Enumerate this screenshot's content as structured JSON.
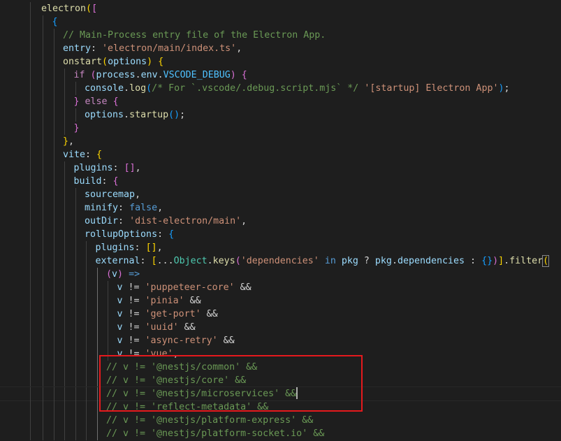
{
  "editor": {
    "highlight_color": "#e5191d",
    "lines": [
      {
        "indent": 0,
        "tokens": [
          {
            "t": "electron",
            "c": "t-fn"
          },
          {
            "t": "(",
            "c": "b1"
          },
          {
            "t": "[",
            "c": "b2"
          }
        ]
      },
      {
        "indent": 1,
        "tokens": [
          {
            "t": "{",
            "c": "b3"
          }
        ]
      },
      {
        "indent": 2,
        "tokens": [
          {
            "t": "// Main-Process entry file of the Electron App.",
            "c": "t-cm"
          }
        ]
      },
      {
        "indent": 2,
        "tokens": [
          {
            "t": "entry",
            "c": "t-prop"
          },
          {
            "t": ": ",
            "c": "t-op"
          },
          {
            "t": "'electron/main/index.ts'",
            "c": "t-str"
          },
          {
            "t": ",",
            "c": "t-op"
          }
        ]
      },
      {
        "indent": 2,
        "tokens": [
          {
            "t": "onstart",
            "c": "t-fn"
          },
          {
            "t": "(",
            "c": "b1"
          },
          {
            "t": "options",
            "c": "t-var"
          },
          {
            "t": ")",
            "c": "b1"
          },
          {
            "t": " ",
            "c": "t-op"
          },
          {
            "t": "{",
            "c": "b1"
          }
        ]
      },
      {
        "indent": 3,
        "tokens": [
          {
            "t": "if",
            "c": "t-kw"
          },
          {
            "t": " ",
            "c": "t-op"
          },
          {
            "t": "(",
            "c": "b2"
          },
          {
            "t": "process",
            "c": "t-var"
          },
          {
            "t": ".",
            "c": "t-op"
          },
          {
            "t": "env",
            "c": "t-var"
          },
          {
            "t": ".",
            "c": "t-op"
          },
          {
            "t": "VSCODE_DEBUG",
            "c": "t-const"
          },
          {
            "t": ")",
            "c": "b2"
          },
          {
            "t": " ",
            "c": "t-op"
          },
          {
            "t": "{",
            "c": "b2"
          }
        ]
      },
      {
        "indent": 4,
        "tokens": [
          {
            "t": "console",
            "c": "t-var"
          },
          {
            "t": ".",
            "c": "t-op"
          },
          {
            "t": "log",
            "c": "t-fn"
          },
          {
            "t": "(",
            "c": "b3"
          },
          {
            "t": "/* For `.vscode/.debug.script.mjs` */",
            "c": "t-cm"
          },
          {
            "t": " ",
            "c": "t-op"
          },
          {
            "t": "'[startup] Electron App'",
            "c": "t-str"
          },
          {
            "t": ")",
            "c": "b3"
          },
          {
            "t": ";",
            "c": "t-op"
          }
        ]
      },
      {
        "indent": 3,
        "tokens": [
          {
            "t": "}",
            "c": "b2"
          },
          {
            "t": " ",
            "c": "t-op"
          },
          {
            "t": "else",
            "c": "t-kw"
          },
          {
            "t": " ",
            "c": "t-op"
          },
          {
            "t": "{",
            "c": "b2"
          }
        ]
      },
      {
        "indent": 4,
        "tokens": [
          {
            "t": "options",
            "c": "t-var"
          },
          {
            "t": ".",
            "c": "t-op"
          },
          {
            "t": "startup",
            "c": "t-fn"
          },
          {
            "t": "(",
            "c": "b3"
          },
          {
            "t": ")",
            "c": "b3"
          },
          {
            "t": ";",
            "c": "t-op"
          }
        ]
      },
      {
        "indent": 3,
        "tokens": [
          {
            "t": "}",
            "c": "b2"
          }
        ]
      },
      {
        "indent": 2,
        "tokens": [
          {
            "t": "}",
            "c": "b1"
          },
          {
            "t": ",",
            "c": "t-op"
          }
        ]
      },
      {
        "indent": 2,
        "tokens": [
          {
            "t": "vite",
            "c": "t-prop"
          },
          {
            "t": ": ",
            "c": "t-op"
          },
          {
            "t": "{",
            "c": "b1"
          }
        ]
      },
      {
        "indent": 3,
        "tokens": [
          {
            "t": "plugins",
            "c": "t-prop"
          },
          {
            "t": ": ",
            "c": "t-op"
          },
          {
            "t": "[]",
            "c": "b2"
          },
          {
            "t": ",",
            "c": "t-op"
          }
        ]
      },
      {
        "indent": 3,
        "tokens": [
          {
            "t": "build",
            "c": "t-prop"
          },
          {
            "t": ": ",
            "c": "t-op"
          },
          {
            "t": "{",
            "c": "b2"
          }
        ]
      },
      {
        "indent": 4,
        "tokens": [
          {
            "t": "sourcemap",
            "c": "t-prop"
          },
          {
            "t": ",",
            "c": "t-op"
          }
        ]
      },
      {
        "indent": 4,
        "tokens": [
          {
            "t": "minify",
            "c": "t-prop"
          },
          {
            "t": ": ",
            "c": "t-op"
          },
          {
            "t": "false",
            "c": "t-kw2"
          },
          {
            "t": ",",
            "c": "t-op"
          }
        ]
      },
      {
        "indent": 4,
        "tokens": [
          {
            "t": "outDir",
            "c": "t-prop"
          },
          {
            "t": ": ",
            "c": "t-op"
          },
          {
            "t": "'dist-electron/main'",
            "c": "t-str"
          },
          {
            "t": ",",
            "c": "t-op"
          }
        ]
      },
      {
        "indent": 4,
        "tokens": [
          {
            "t": "rollupOptions",
            "c": "t-prop"
          },
          {
            "t": ": ",
            "c": "t-op"
          },
          {
            "t": "{",
            "c": "b3"
          }
        ]
      },
      {
        "indent": 5,
        "tokens": [
          {
            "t": "plugins",
            "c": "t-prop"
          },
          {
            "t": ": ",
            "c": "t-op"
          },
          {
            "t": "[]",
            "c": "b1"
          },
          {
            "t": ",",
            "c": "t-op"
          }
        ]
      },
      {
        "indent": 5,
        "tokens": [
          {
            "t": "external",
            "c": "t-prop"
          },
          {
            "t": ": ",
            "c": "t-op"
          },
          {
            "t": "[",
            "c": "b1"
          },
          {
            "t": "...",
            "c": "t-op"
          },
          {
            "t": "Object",
            "c": "t-type"
          },
          {
            "t": ".",
            "c": "t-op"
          },
          {
            "t": "keys",
            "c": "t-fn"
          },
          {
            "t": "(",
            "c": "b2"
          },
          {
            "t": "'dependencies'",
            "c": "t-str"
          },
          {
            "t": " ",
            "c": "t-op"
          },
          {
            "t": "in",
            "c": "t-kw2"
          },
          {
            "t": " ",
            "c": "t-op"
          },
          {
            "t": "pkg",
            "c": "t-var"
          },
          {
            "t": " ? ",
            "c": "t-op"
          },
          {
            "t": "pkg",
            "c": "t-var"
          },
          {
            "t": ".",
            "c": "t-op"
          },
          {
            "t": "dependencies",
            "c": "t-var"
          },
          {
            "t": " : ",
            "c": "t-op"
          },
          {
            "t": "{}",
            "c": "b3"
          },
          {
            "t": ")",
            "c": "b2"
          },
          {
            "t": "]",
            "c": "b1"
          },
          {
            "t": ".",
            "c": "t-op"
          },
          {
            "t": "filter",
            "c": "t-fn"
          },
          {
            "t": "(",
            "c": "b1 bracket-match"
          }
        ]
      },
      {
        "indent": 6,
        "tokens": [
          {
            "t": "(",
            "c": "b2"
          },
          {
            "t": "v",
            "c": "t-var"
          },
          {
            "t": ")",
            "c": "b2"
          },
          {
            "t": " ",
            "c": "t-op"
          },
          {
            "t": "=>",
            "c": "t-kw2"
          }
        ]
      },
      {
        "indent": 7,
        "tokens": [
          {
            "t": "v",
            "c": "t-var"
          },
          {
            "t": " != ",
            "c": "t-op"
          },
          {
            "t": "'puppeteer-core'",
            "c": "t-str"
          },
          {
            "t": " &&",
            "c": "t-op"
          }
        ]
      },
      {
        "indent": 7,
        "tokens": [
          {
            "t": "v",
            "c": "t-var"
          },
          {
            "t": " != ",
            "c": "t-op"
          },
          {
            "t": "'pinia'",
            "c": "t-str"
          },
          {
            "t": " &&",
            "c": "t-op"
          }
        ]
      },
      {
        "indent": 7,
        "tokens": [
          {
            "t": "v",
            "c": "t-var"
          },
          {
            "t": " != ",
            "c": "t-op"
          },
          {
            "t": "'get-port'",
            "c": "t-str"
          },
          {
            "t": " &&",
            "c": "t-op"
          }
        ]
      },
      {
        "indent": 7,
        "tokens": [
          {
            "t": "v",
            "c": "t-var"
          },
          {
            "t": " != ",
            "c": "t-op"
          },
          {
            "t": "'uuid'",
            "c": "t-str"
          },
          {
            "t": " &&",
            "c": "t-op"
          }
        ]
      },
      {
        "indent": 7,
        "tokens": [
          {
            "t": "v",
            "c": "t-var"
          },
          {
            "t": " != ",
            "c": "t-op"
          },
          {
            "t": "'async-retry'",
            "c": "t-str"
          },
          {
            "t": " &&",
            "c": "t-op"
          }
        ]
      },
      {
        "indent": 7,
        "tokens": [
          {
            "t": "v",
            "c": "t-var"
          },
          {
            "t": " != ",
            "c": "t-op"
          },
          {
            "t": "'vue'",
            "c": "t-str"
          },
          {
            "t": ",",
            "c": "t-op"
          }
        ]
      },
      {
        "indent": 6,
        "tokens": [
          {
            "t": "// v != '@nestjs/common' &&",
            "c": "t-cm"
          }
        ]
      },
      {
        "indent": 6,
        "tokens": [
          {
            "t": "// v != '@nestjs/core' &&",
            "c": "t-cm"
          }
        ]
      },
      {
        "indent": 6,
        "cursor": true,
        "tokens": [
          {
            "t": "// v != '@nestjs/microservices' &&",
            "c": "t-cm"
          }
        ]
      },
      {
        "indent": 6,
        "tokens": [
          {
            "t": "// v != 'reflect-metadata' &&",
            "c": "t-cm"
          }
        ]
      },
      {
        "indent": 6,
        "tokens": [
          {
            "t": "// v != '@nestjs/platform-express' &&",
            "c": "t-cm"
          }
        ]
      },
      {
        "indent": 6,
        "tokens": [
          {
            "t": "// v != '@nestjs/platform-socket.io' &&",
            "c": "t-cm"
          }
        ]
      }
    ]
  }
}
